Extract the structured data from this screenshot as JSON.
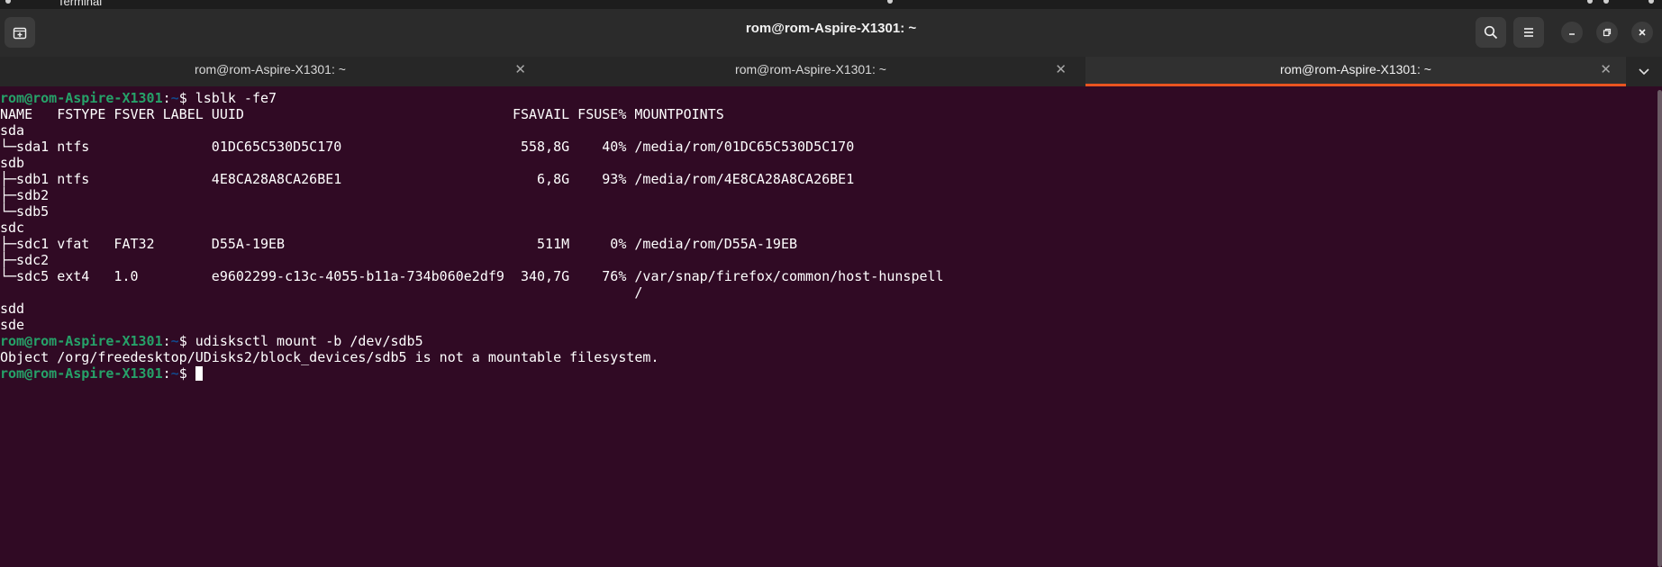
{
  "window": {
    "title": "rom@rom-Aspire-X1301: ~",
    "app_name": "Terminal"
  },
  "tabs": [
    {
      "label": "rom@rom-Aspire-X1301: ~",
      "active": false
    },
    {
      "label": "rom@rom-Aspire-X1301: ~",
      "active": false
    },
    {
      "label": "rom@rom-Aspire-X1301: ~",
      "active": true
    }
  ],
  "colors": {
    "accent": "#e95420",
    "terminal_bg": "#300a24",
    "prompt_user": "#26a269",
    "prompt_path": "#12488b"
  },
  "icons": {
    "new_tab": "new-tab-icon",
    "search": "search-icon",
    "menu": "hamburger-menu-icon",
    "minimize": "minimize-icon",
    "maximize": "restore-icon",
    "close": "close-icon",
    "tab_overflow": "chevron-down-icon"
  },
  "terminal": {
    "prompt_user": "rom@rom-Aspire-X1301",
    "prompt_sep": ":",
    "prompt_path": "~",
    "prompt_dollar": "$ ",
    "lines": [
      {
        "type": "prompt",
        "command": "lsblk -fe7"
      },
      {
        "type": "output",
        "text": "NAME   FSTYPE FSVER LABEL UUID                                 FSAVAIL FSUSE% MOUNTPOINTS"
      },
      {
        "type": "output",
        "text": "sda"
      },
      {
        "type": "output",
        "text": "└─sda1 ntfs               01DC65C530D5C170                      558,8G    40% /media/rom/01DC65C530D5C170"
      },
      {
        "type": "output",
        "text": "sdb"
      },
      {
        "type": "output",
        "text": "├─sdb1 ntfs               4E8CA28A8CA26BE1                        6,8G    93% /media/rom/4E8CA28A8CA26BE1"
      },
      {
        "type": "output",
        "text": "├─sdb2"
      },
      {
        "type": "output",
        "text": "└─sdb5"
      },
      {
        "type": "output",
        "text": "sdc"
      },
      {
        "type": "output",
        "text": "├─sdc1 vfat   FAT32       D55A-19EB                               511M     0% /media/rom/D55A-19EB"
      },
      {
        "type": "output",
        "text": "├─sdc2"
      },
      {
        "type": "output",
        "text": "└─sdc5 ext4   1.0         e9602299-c13c-4055-b11a-734b060e2df9  340,7G    76% /var/snap/firefox/common/host-hunspell"
      },
      {
        "type": "output",
        "text": "                                                                              /"
      },
      {
        "type": "output",
        "text": "sdd"
      },
      {
        "type": "output",
        "text": "sde"
      },
      {
        "type": "prompt",
        "command": "udisksctl mount -b /dev/sdb5"
      },
      {
        "type": "output",
        "text": "Object /org/freedesktop/UDisks2/block_devices/sdb5 is not a mountable filesystem."
      },
      {
        "type": "prompt-cursor",
        "command": ""
      }
    ]
  }
}
